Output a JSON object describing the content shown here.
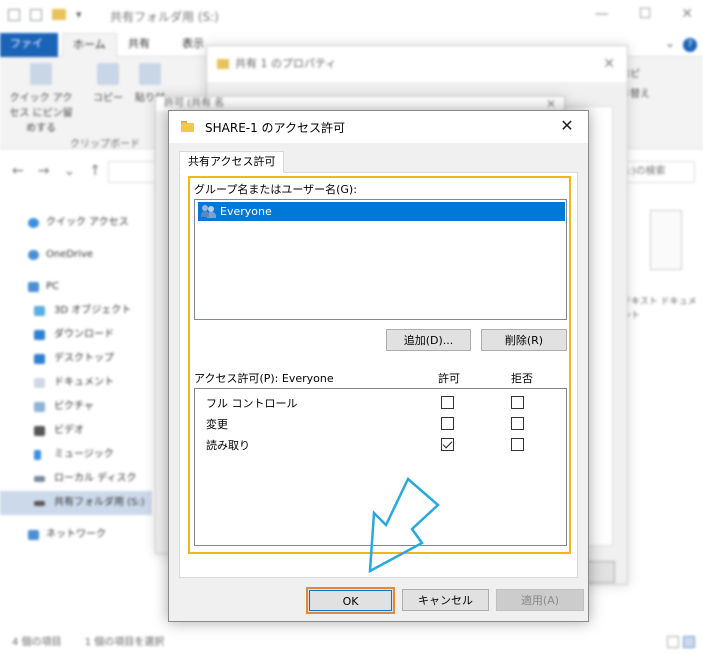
{
  "explorer": {
    "window_title": "共有フォルダ用 (S:)",
    "ribbon_tabs": [
      "ファイル",
      "ホーム",
      "共有",
      "表示"
    ],
    "ribbon_buttons": [
      "クイック アクセス にピン留めする",
      "コピー",
      "貼り付"
    ],
    "ribbon_group_label": "クリップボード",
    "ribbon_right": [
      "コピ",
      "り替え"
    ],
    "search_placeholder": "(S:)の検索",
    "nav_items": [
      {
        "label": "クイック アクセス",
        "icon": "star-icon"
      },
      {
        "label": "OneDrive",
        "icon": "cloud-icon"
      },
      {
        "label": "PC",
        "icon": "pc-icon"
      },
      {
        "label": "3D オブジェクト",
        "icon": "3d-objects-icon"
      },
      {
        "label": "ダウンロード",
        "icon": "download-icon"
      },
      {
        "label": "デスクトップ",
        "icon": "desktop-icon"
      },
      {
        "label": "ドキュメント",
        "icon": "documents-icon"
      },
      {
        "label": "ピクチャ",
        "icon": "pictures-icon"
      },
      {
        "label": "ビデオ",
        "icon": "video-icon"
      },
      {
        "label": "ミュージック",
        "icon": "music-icon"
      },
      {
        "label": "ローカル ディスク (C:)",
        "icon": "disk-icon"
      },
      {
        "label": "共有フォルダ用 (S:)",
        "icon": "drive-icon",
        "selected": true
      },
      {
        "label": "ネットワーク",
        "icon": "network-icon"
      }
    ],
    "content_item_label": "テキスト ドキュメント",
    "status": {
      "count": "4 個の項目",
      "selected": "1 個の項目を選択"
    }
  },
  "properties_dialog": {
    "title": "共有 1 のプロパティ"
  },
  "permissions_dialog_bg": {
    "title": "許可 (共有 名"
  },
  "dialog": {
    "title": "SHARE-1 のアクセス許可",
    "tab": "共有アクセス許可",
    "group_label": "グループ名またはユーザー名(G):",
    "users": [
      {
        "name": "Everyone",
        "selected": true
      }
    ],
    "add_button": "追加(D)...",
    "remove_button": "削除(R)",
    "perm_label": "アクセス許可(P): Everyone",
    "allow_header": "許可",
    "deny_header": "拒否",
    "permissions": [
      {
        "name": "フル コントロール",
        "allow": false,
        "deny": false
      },
      {
        "name": "変更",
        "allow": false,
        "deny": false
      },
      {
        "name": "読み取り",
        "allow": true,
        "deny": false
      }
    ],
    "ok_button": "OK",
    "cancel_button": "キャンセル",
    "apply_button": "適用(A)"
  },
  "colors": {
    "highlight_border": "#f3b718",
    "selection": "#0078d7",
    "arrow": "#29a8e0",
    "ok_focus": "#e5883a"
  }
}
